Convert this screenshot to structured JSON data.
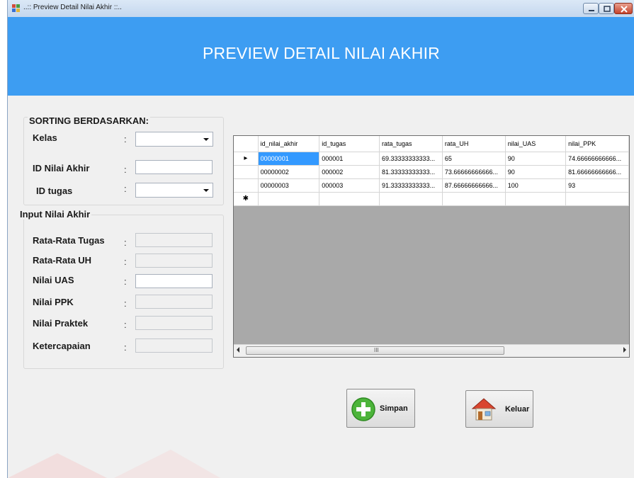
{
  "window": {
    "title": "..:: Preview Detail Nilai Akhir ::.."
  },
  "banner": {
    "heading": "PREVIEW DETAIL NILAI AKHIR"
  },
  "sorting": {
    "group_title": "SORTING BERDASARKAN:",
    "kelas_label": "Kelas",
    "kelas_value": "",
    "id_nilai_akhir_label": "ID Nilai Akhir",
    "id_nilai_akhir_value": "",
    "id_tugas_label": "ID tugas",
    "id_tugas_value": "",
    "colon": ":"
  },
  "input": {
    "group_title": "Input Nilai Akhir",
    "rata_tugas_label": "Rata-Rata Tugas",
    "rata_uh_label": "Rata-Rata UH",
    "nilai_uas_label": "Nilai UAS",
    "nilai_ppk_label": "Nilai PPK",
    "nilai_praktek_label": "Nilai Praktek",
    "ketercapaian_label": "Ketercapaian",
    "colon": ":"
  },
  "grid": {
    "columns": [
      "id_nilai_akhir",
      "id_tugas",
      "rata_tugas",
      "rata_UH",
      "nilai_UAS",
      "nilai_PPK"
    ],
    "rows": [
      {
        "marker": "▸",
        "cells": [
          "00000001",
          "000001",
          "69.33333333333...",
          "65",
          "90",
          "74.66666666666..."
        ]
      },
      {
        "marker": "",
        "cells": [
          "00000002",
          "000002",
          "81.33333333333...",
          "73.66666666666...",
          "90",
          "81.66666666666..."
        ]
      },
      {
        "marker": "",
        "cells": [
          "00000003",
          "000003",
          "91.33333333333...",
          "87.66666666666...",
          "100",
          "93"
        ]
      }
    ],
    "new_row_marker": "✱",
    "scroll_grip": "III"
  },
  "buttons": {
    "simpan_label": "Simpan",
    "keluar_label": "Keluar"
  },
  "colors": {
    "banner": "#3d9df2",
    "selected_cell": "#3399ff",
    "form_bg": "#f0f0f0"
  }
}
